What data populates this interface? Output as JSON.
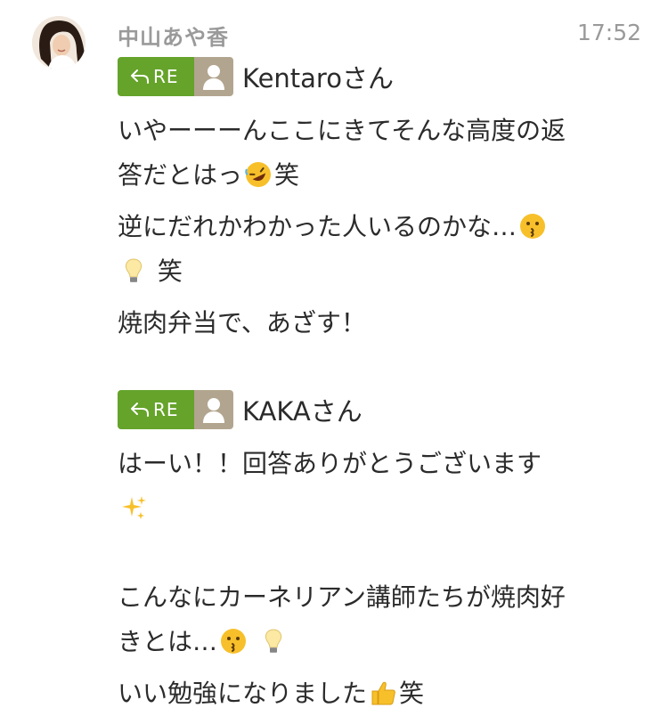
{
  "message": {
    "sender_name": "中山あや香",
    "time": "17:52",
    "avatar_icon": "profile-photo",
    "reply_badge_label": "RE",
    "replies": [
      {
        "reply_to": "Kentaroさん",
        "lines": [
          "いやーーーんここにきてそんな高度の返",
          "答だとはっ",
          "笑",
          "逆にだれかわかった人いるのかな…",
          "笑",
          "焼肉弁当で、あざす！"
        ]
      },
      {
        "reply_to": "KAKAさん",
        "lines": [
          "はーい！！回答ありがとうございます",
          "こんなにカーネリアン講師たちが焼肉好",
          "きとは…",
          "いい勉強になりました",
          "笑"
        ]
      }
    ],
    "colors": {
      "re_badge": "#65a32a",
      "user_chip": "#b2a58f",
      "meta_text": "#9a9a9a"
    }
  }
}
